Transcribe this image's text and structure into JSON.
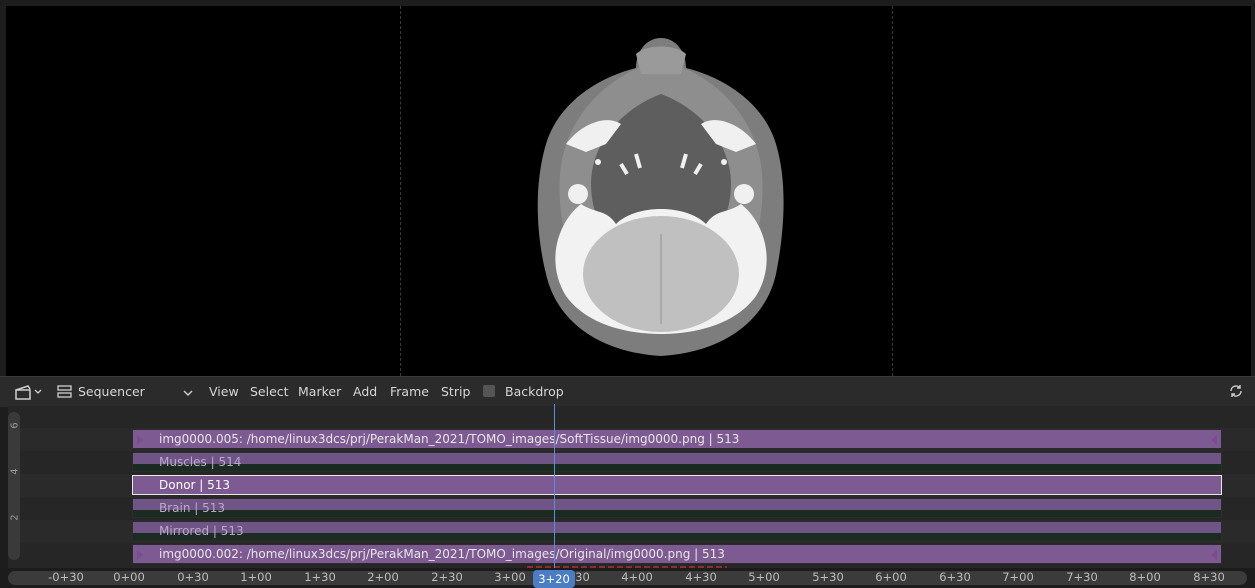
{
  "header": {
    "editor_name": "Sequencer",
    "menus": [
      "View",
      "Select",
      "Marker",
      "Add",
      "Frame",
      "Strip"
    ],
    "backdrop_label": "Backdrop"
  },
  "channels": [
    "6",
    "4",
    "2"
  ],
  "strips": [
    {
      "label": "img0000.005: /home/linux3dcs/prj/PerakMan_2021/TOMO_images/SoftTissue/img0000.png | 513"
    },
    {
      "label": "Muscles | 514"
    },
    {
      "label": "Donor | 513"
    },
    {
      "label": "Brain | 513"
    },
    {
      "label": "Mirrored | 513"
    },
    {
      "label": "img0000.002: /home/linux3dcs/prj/PerakMan_2021/TOMO_images/Original/img0000.png | 513"
    }
  ],
  "ruler": {
    "ticks": [
      "-0+30",
      "0+00",
      "0+30",
      "1+00",
      "1+30",
      "2+00",
      "2+30",
      "3+00",
      "3+30",
      "4+00",
      "4+30",
      "5+00",
      "5+30",
      "6+00",
      "6+30",
      "7+00",
      "7+30",
      "8+00",
      "8+30"
    ],
    "current_frame": "3+20"
  },
  "icons": {
    "editor_type": "clapperboard-icon",
    "sequencer": "sequencer-icon",
    "refresh": "refresh-icon"
  },
  "colors": {
    "strip_purple": "#7e5a92",
    "strip_selected_border": "#e8e8e8",
    "playhead": "#5b8fd8"
  }
}
